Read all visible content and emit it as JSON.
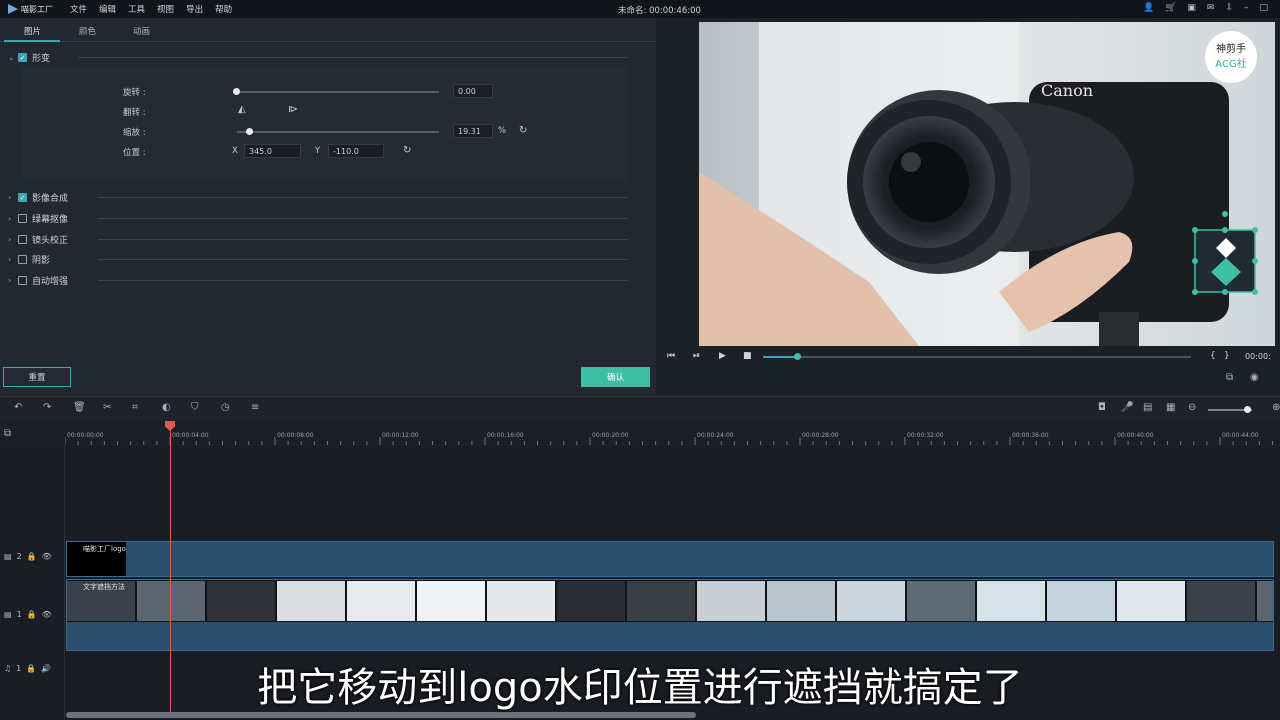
{
  "app": {
    "name": "喵影工厂",
    "title": "未命名: 00:00:46:00"
  },
  "menu": [
    "文件",
    "编辑",
    "工具",
    "视图",
    "导出",
    "帮助"
  ],
  "tabs": [
    "图片",
    "颜色",
    "动画"
  ],
  "transform": {
    "section_label": "形变",
    "rotate_label": "旋转 :",
    "rotate_value": "0.00",
    "flip_label": "翻转 :",
    "scale_label": "缩放 :",
    "scale_value": "19.31",
    "scale_unit": "%",
    "scale_level": 0.06,
    "position_label": "位置 :",
    "x_label": "X",
    "x_value": "345.0",
    "y_label": "Y",
    "y_value": "-110.0"
  },
  "sections": [
    {
      "label": "影像合成",
      "checked": true
    },
    {
      "label": "绿幕抠像",
      "checked": false
    },
    {
      "label": "镜头校正",
      "checked": false
    },
    {
      "label": "阴影",
      "checked": false
    },
    {
      "label": "自动增强",
      "checked": false
    }
  ],
  "buttons": {
    "reset": "重置",
    "ok": "确认"
  },
  "preview": {
    "timecode": "00:00:",
    "progress": 0.08,
    "watermark_line1": "神剪手",
    "watermark_line2": "ACG社",
    "camera_brand": "Canon"
  },
  "ruler": [
    "00:00:00:00",
    "00:00:04:00",
    "00:00:08:00",
    "00:00:12:00",
    "00:00:16:00",
    "00:00:20:00",
    "00:00:24:00",
    "00:00:28:00",
    "00:00:32:00",
    "00:00:36:00",
    "00:00:40:00",
    "00:00:44:00"
  ],
  "tracks": {
    "track2_label": "2",
    "track1_label": "1",
    "audio_label": "1",
    "logo_clip_name": "喵影工厂logo",
    "video_clip_name": "文字遮挡方法"
  },
  "subtitle": "把它移动到logo水印位置进行遮挡就搞定了",
  "colors": {
    "accent": "#3aa6b9",
    "ok": "#3ebfa4",
    "playhead": "#e05a4c"
  }
}
